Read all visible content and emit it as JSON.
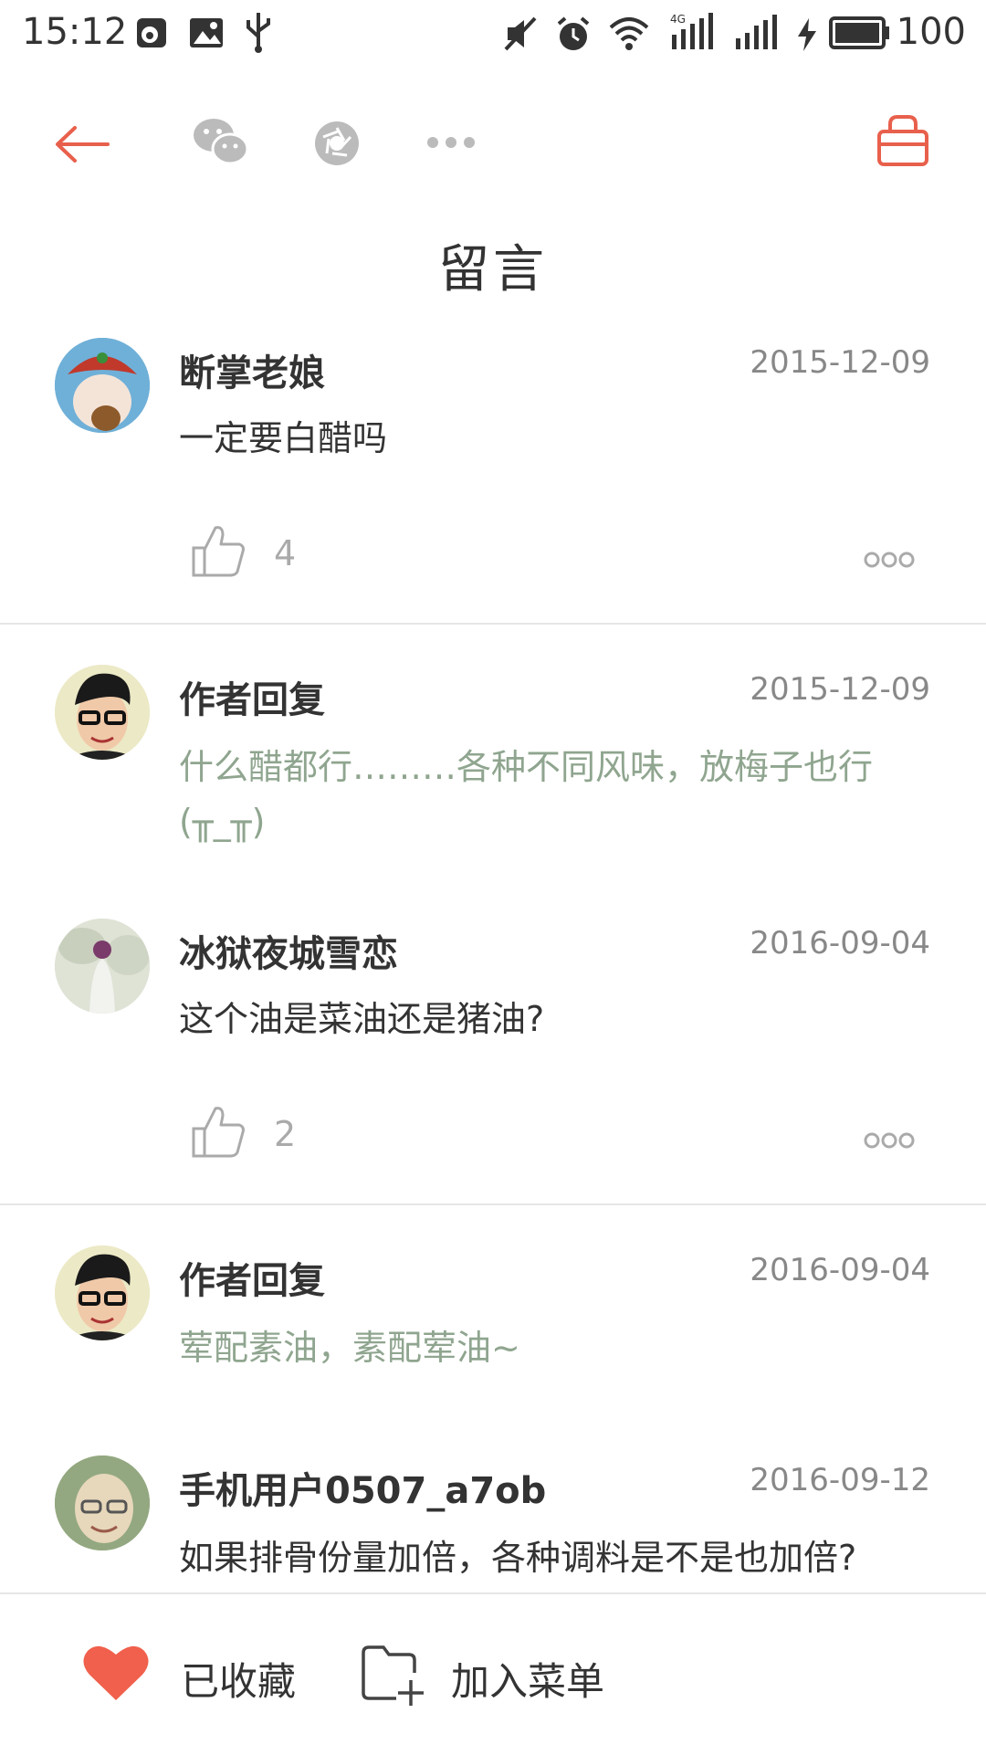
{
  "status": {
    "time": "15:12",
    "battery": "100",
    "network": "4G",
    "left_icons": [
      "weibo-icon",
      "image-icon",
      "usb-icon"
    ],
    "right_icons": [
      "mute-icon",
      "alarm-icon",
      "wifi-icon",
      "signal-4g-icon",
      "signal-icon",
      "charging-icon",
      "battery-icon"
    ]
  },
  "toolbar": {
    "icons": [
      "back-arrow-icon",
      "wechat-icon",
      "moments-icon",
      "more-dots-icon",
      "basket-icon"
    ],
    "accent": "#e8604c"
  },
  "page": {
    "title": "留言"
  },
  "comments": [
    {
      "name": "断掌老娘",
      "date": "2015-12-09",
      "text": "一定要白醋吗",
      "likes": "4",
      "is_reply": false
    },
    {
      "name": "作者回复",
      "date": "2015-12-09",
      "text": "什么醋都行………各种不同风味，放梅子也行(╥_╥)",
      "is_reply": true
    },
    {
      "name": "冰狱夜城雪恋",
      "date": "2016-09-04",
      "text": "这个油是菜油还是猪油?",
      "likes": "2",
      "is_reply": false
    },
    {
      "name": "作者回复",
      "date": "2016-09-04",
      "text": "荤配素油，素配荤油~",
      "is_reply": true
    },
    {
      "name": "手机用户0507_a7ob",
      "date": "2016-09-12",
      "text": "如果排骨份量加倍，各种调料是不是也加倍?",
      "is_reply": false
    }
  ],
  "bottom": {
    "favorite_label": "已收藏",
    "add_menu_label": "加入菜单",
    "heart_color": "#f0604c"
  }
}
